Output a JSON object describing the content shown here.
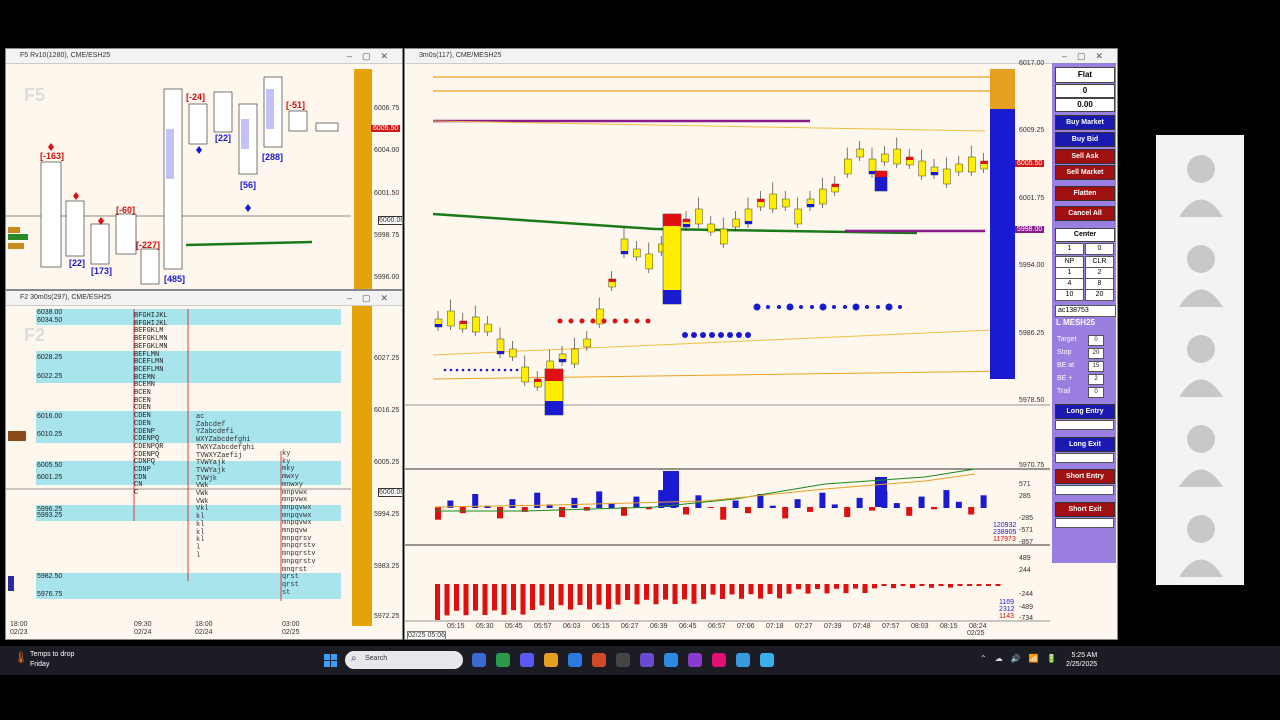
{
  "win1": {
    "title": "F5 Rv10(1280), CME/ESH25",
    "ghost": "F5",
    "prices": [
      "6006.75",
      "6004.00",
      "6001.50",
      "6000.00",
      "5998.75",
      "5996.00"
    ],
    "last_tag": "6005.50",
    "labels_red": [
      "[-163]",
      "[-60]",
      "[-227]",
      "[-24]",
      "[-51]"
    ],
    "labels_blue": [
      "[22]",
      "[173]",
      "[485]",
      "[22]",
      "[56]",
      "[288]"
    ]
  },
  "win2": {
    "title": "F2 30m0s(297), CME/ESH25",
    "ghost": "F2",
    "level_labels": [
      "6038.00",
      "6034.50",
      "6028.25",
      "6022.25",
      "6016.00",
      "6010.25",
      "6005.50",
      "6001.25",
      "5996.25",
      "5993.25",
      "5982.50",
      "5976.75"
    ],
    "prices": [
      "6027.25",
      "6016.25",
      "6005.25",
      "5994.25",
      "5983.25",
      "5972.25"
    ],
    "current_tag": "6000.00",
    "x_ticks": [
      {
        "t": "18:00",
        "d": "02/23"
      },
      {
        "t": "09:30",
        "d": "02/24"
      },
      {
        "t": "18:00",
        "d": "02/24"
      },
      {
        "t": "03:00",
        "d": "02/25"
      }
    ],
    "profile_rows": [
      "BFGHIJKL",
      "BFGHIJKL",
      "BEFGKLM",
      "BEFGKLMN",
      "BEFGKLMN",
      "BEFLMN",
      "BCEFLMN",
      "BCEFLMN",
      "BCEMN",
      "BCEMN",
      "BCEN",
      "BCEN",
      "CDEN",
      "CDEN",
      "CDEN",
      "CDENP",
      "CDENPQ",
      "CDENPQR",
      "CDENPQ",
      "CDNPQ",
      "CDNP",
      "CDN",
      "CN",
      "C"
    ],
    "profile2_rows": [
      "ac",
      "Zabcdef",
      "YZabcdefi",
      "WXYZabcdefghi",
      "TWXYZabcdefghi",
      "TVWXYZaefij",
      "TVWYajk",
      "TVWYajk",
      "TVWjk",
      "VWk",
      "VWk",
      "VWk",
      "Vkl",
      "kl",
      "kl",
      "kl",
      "kl",
      "l",
      "l"
    ],
    "profile3_rows": [
      "ky",
      "ky",
      "mky",
      "mwxy",
      "mnwxy",
      "mnpvwx",
      "mnpvwx",
      "mnpqvwx",
      "mnpqvwx",
      "mnpqvwx",
      "mnpqvw",
      "mnpqrsv",
      "mnpqrstv",
      "mnpqrstv",
      "mnpqrstv",
      "mnqrst",
      "qrst",
      "qrst",
      "st"
    ]
  },
  "win3": {
    "title": "3m0s(117), CME/MESH25",
    "prices": [
      "6017.00",
      "6009.25",
      "6001.75",
      "5994.00",
      "5986.25",
      "5978.50",
      "5970.75"
    ],
    "last_tag": "6005.50",
    "vwap_tag": "5998.00",
    "vol_values": [
      "571",
      "285",
      "-285",
      "-571",
      "-857"
    ],
    "vol_readouts": [
      "120932",
      "238905",
      "117973"
    ],
    "delta_values": [
      "489",
      "244",
      "-244",
      "-489",
      "-734"
    ],
    "delta_readouts": [
      "1169",
      "2312",
      "1143"
    ],
    "x_ticks": [
      "05:15",
      "05:30",
      "05:45",
      "05:57",
      "06:03",
      "06:15",
      "06:27",
      "06:39",
      "06:45",
      "06:57",
      "07:06",
      "07:18",
      "07:27",
      "07:39",
      "07:48",
      "07:57",
      "08:03",
      "08:15",
      "08:24"
    ],
    "date_start": "02/25 05:06",
    "date_end": "02/25"
  },
  "panel": {
    "status": "Flat",
    "position": "0",
    "pnl": "0.00",
    "buy_market": "Buy Market",
    "buy_bid": "Buy Bid",
    "sell_ask": "Sell Ask",
    "sell_market": "Sell Market",
    "flatten": "Flatten",
    "cancel_all": "Cancel All",
    "center": "Center",
    "qty": "1",
    "qty2": "0",
    "np": "NP",
    "clr": "CLR",
    "grid": [
      "1",
      "2",
      "4",
      "8",
      "10",
      "20"
    ],
    "account": "ac138753",
    "symbol": "L MESH25",
    "target_label": "Target",
    "target_val": "0",
    "stop_label": "Stop",
    "stop_val": "20",
    "beat_label": "BE at",
    "beat_val": "15",
    "beplus_label": "BE +",
    "beplus_val": "2",
    "trail_label": "Trail",
    "trail_val": "0",
    "long_entry": "Long Entry",
    "long_exit": "Long Exit",
    "short_entry": "Short Entry",
    "short_exit": "Short Exit",
    "colors": {
      "blue": "#1a1ab0",
      "red": "#a01010",
      "purple": "#9a7fe0"
    }
  },
  "taskbar": {
    "weather_line1": "Temps to drop",
    "weather_line2": "Friday",
    "search_placeholder": "Search",
    "time": "5:25 AM",
    "date": "2/25/2025"
  }
}
